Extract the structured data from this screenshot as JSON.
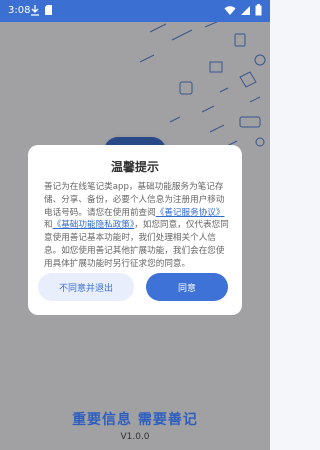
{
  "status_bar": {
    "time": "3:08"
  },
  "branding": {
    "slogan": "重要信息 需要善记",
    "version": "V1.0.0"
  },
  "dialog": {
    "title": "温馨提示",
    "body_part1": "善记为在线笔记类app，基础功能服务为笔记存储、分享、备份，必要个人信息为注册用户移动电话号码。请您在使用前查阅",
    "link_service": "《善记服务协议》",
    "and_text": "和",
    "link_privacy": "《基础功能隐私政策》",
    "body_part2": "，如您同意，仅代表您同意使用善记基本功能时，我们处理相关个人信息。如您使用善记其他扩展功能，我们会在您使用具体扩展功能时另行征求您的同意。",
    "disagree_label": "不同意并退出",
    "agree_label": "同意"
  },
  "colors": {
    "primary": "#3f72d6",
    "status_bar": "#3b6fd1",
    "link": "#2f6ad0"
  }
}
